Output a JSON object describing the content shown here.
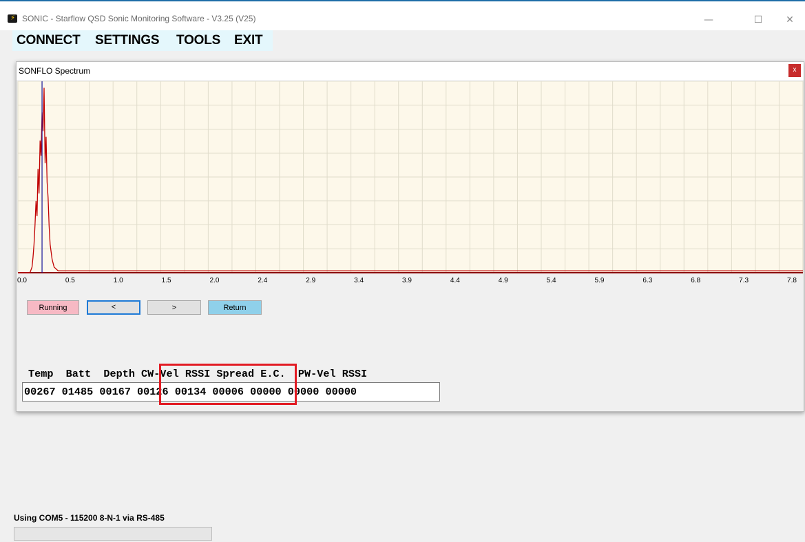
{
  "window": {
    "title": "SONIC - Starflow QSD Sonic Monitoring Software - V3.25 (V25)",
    "minimize_glyph": "—",
    "maximize_glyph": "☐",
    "close_glyph": "✕"
  },
  "menu": {
    "items": [
      "CONNECT",
      "SETTINGS",
      "TOOLS",
      "EXIT"
    ]
  },
  "spectrum": {
    "title": "SONFLO Spectrum",
    "close_label": "x",
    "buttons": {
      "running": "Running",
      "prev": "<",
      "next": ">",
      "return": "Return"
    }
  },
  "chart_data": {
    "type": "line",
    "x_tick_labels": [
      "0.0",
      "0.5",
      "1.0",
      "1.5",
      "2.0",
      "2.4",
      "2.9",
      "3.4",
      "3.9",
      "4.4",
      "4.9",
      "5.4",
      "5.9",
      "6.3",
      "6.8",
      "7.3",
      "7.8"
    ],
    "xlim": [
      0,
      7.8
    ],
    "ylim": [
      0,
      1
    ],
    "grid": true,
    "marker_x": 0.24,
    "series": [
      {
        "color": "#c00000",
        "x": [
          0.0,
          0.12,
          0.14,
          0.15,
          0.16,
          0.17,
          0.18,
          0.19,
          0.2,
          0.21,
          0.22,
          0.23,
          0.24,
          0.25,
          0.26,
          0.27,
          0.28,
          0.29,
          0.3,
          0.31,
          0.32,
          0.34,
          0.36,
          0.4,
          7.8
        ],
        "y": [
          0.0,
          0.0,
          0.03,
          0.08,
          0.15,
          0.25,
          0.38,
          0.3,
          0.55,
          0.42,
          0.7,
          0.62,
          0.85,
          0.75,
          0.98,
          0.58,
          0.72,
          0.48,
          0.4,
          0.25,
          0.15,
          0.07,
          0.03,
          0.01,
          0.01
        ]
      }
    ],
    "colors": {
      "background": "#fdf8ea",
      "grid": "#e0dccb",
      "axis": "#8b0000",
      "marker": "#1f1fa0"
    }
  },
  "readout": {
    "header": "Temp  Batt  Depth CW-Vel RSSI Spread E.C.  PW-Vel RSSI",
    "values": "00267 01485 00167 00126 00134 00006 00000 00000 00000"
  },
  "status": {
    "connection": "Using COM5 - 115200 8-N-1 via RS-485",
    "progress": 0
  }
}
